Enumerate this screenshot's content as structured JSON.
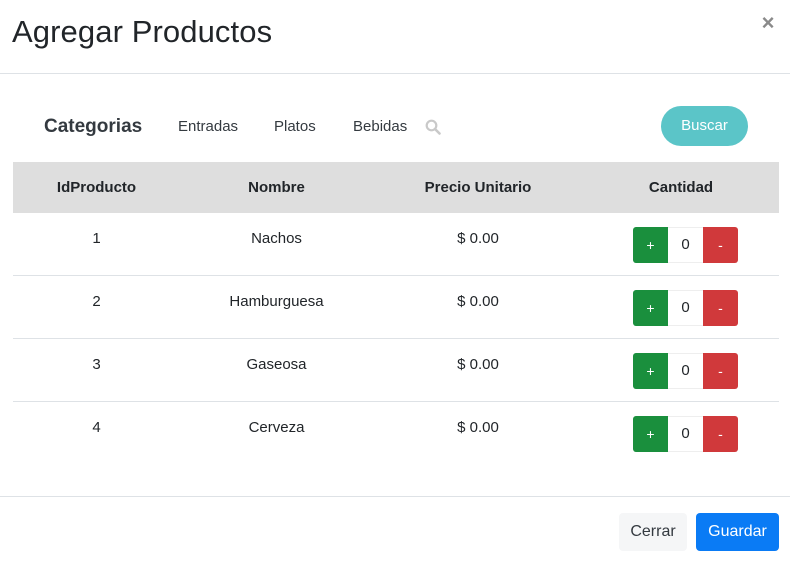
{
  "modal": {
    "title": "Agregar Productos",
    "close_label": "×"
  },
  "toolbar": {
    "categories_title": "Categorias",
    "categories": [
      "Entradas",
      "Platos",
      "Bebidas"
    ],
    "search_icon": "search-icon",
    "search_button": "Buscar"
  },
  "table": {
    "headers": [
      "IdProducto",
      "Nombre",
      "Precio Unitario",
      "Cantidad"
    ],
    "rows": [
      {
        "id": "1",
        "name": "Nachos",
        "price": "$ 0.00",
        "qty": "0"
      },
      {
        "id": "2",
        "name": "Hamburguesa",
        "price": "$ 0.00",
        "qty": "0"
      },
      {
        "id": "3",
        "name": "Gaseosa",
        "price": "$ 0.00",
        "qty": "0"
      },
      {
        "id": "4",
        "name": "Cerveza",
        "price": "$ 0.00",
        "qty": "0"
      }
    ],
    "plus_label": "+",
    "minus_label": "-"
  },
  "footer": {
    "close_button": "Cerrar",
    "save_button": "Guardar"
  },
  "colors": {
    "search_button": "#5bc5c8",
    "plus": "#1a8f3d",
    "minus": "#d0393b",
    "save": "#0a7bf5",
    "header_bg": "#dedede"
  }
}
